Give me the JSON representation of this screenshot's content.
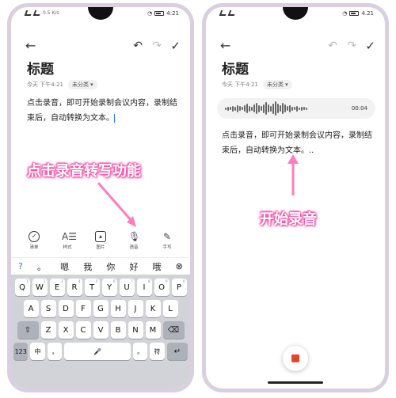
{
  "status": {
    "time": "4:21",
    "net_left": "0.5 K/s",
    "net_right": "4.21"
  },
  "note": {
    "title": "标题",
    "date": "今天 下午4:21",
    "category": "未分类",
    "body": "点击录音，即可开始录制会议内容，录制结束后，自动转换为文本。",
    "body_recording": "点击录音，即可开始录制会议内容，录制结束后，自动转换为文本。.."
  },
  "callouts": {
    "left": "点击录音转写功能",
    "right": "开始录音"
  },
  "tools": [
    {
      "label": "清单",
      "icon": "checklist-icon"
    },
    {
      "label": "样式",
      "icon": "text-style-icon"
    },
    {
      "label": "图片",
      "icon": "image-icon"
    },
    {
      "label": "语音",
      "icon": "microphone-icon"
    },
    {
      "label": "手写",
      "icon": "pen-icon"
    }
  ],
  "candidates": [
    "?",
    "。",
    "嗯",
    "我",
    "你",
    "好",
    "哦"
  ],
  "keyboard": {
    "row1": [
      "Q",
      "W",
      "E",
      "R",
      "T",
      "Y",
      "U",
      "I",
      "O",
      "P"
    ],
    "row1_sub": [
      "1",
      "2",
      "3",
      "4",
      "5",
      "6",
      "7",
      "8",
      "9",
      "0"
    ],
    "row2": [
      "A",
      "S",
      "D",
      "F",
      "G",
      "H",
      "J",
      "K",
      "L"
    ],
    "row3": [
      "Z",
      "X",
      "C",
      "V",
      "B",
      "N",
      "M"
    ],
    "num": "123",
    "lang": "中",
    "comma": "，",
    "punct": "。",
    "symbol": "符"
  },
  "recording": {
    "timer": "00:04"
  }
}
